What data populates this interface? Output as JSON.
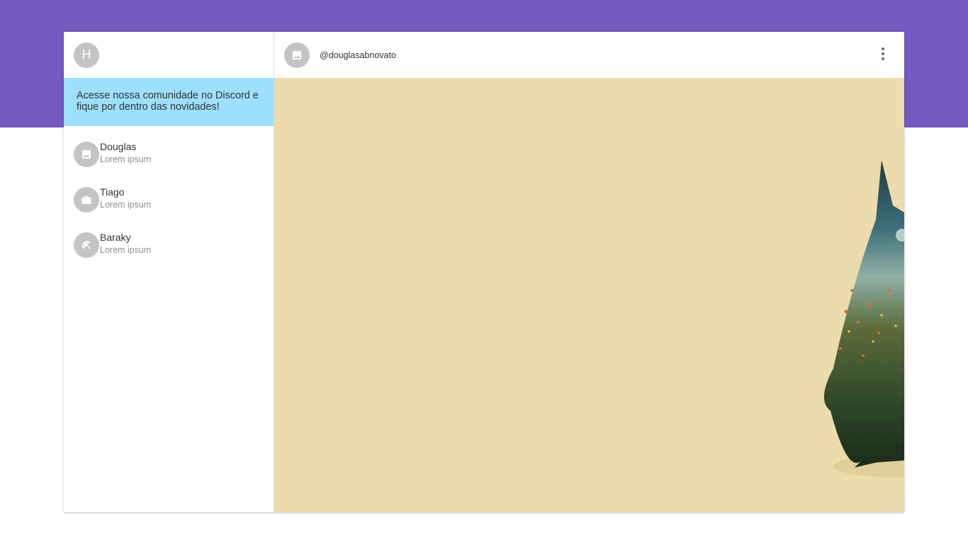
{
  "sidebar": {
    "profile_initial": "H",
    "banner_text": "Acesse nossa comunidade no Discord e fique por dentro das novidades!",
    "contacts": [
      {
        "name": "Douglas",
        "subtitle": "Lorem ipsum",
        "icon": "image-icon"
      },
      {
        "name": "Tiago",
        "subtitle": "Lorem ipsum",
        "icon": "briefcase-icon"
      },
      {
        "name": "Baraky",
        "subtitle": "Lorem ipsum",
        "icon": "beach-umbrella-icon"
      }
    ]
  },
  "chat": {
    "title": "@douglasabnovato",
    "avatar_icon": "image-icon",
    "menu_icon": "more-vert-icon"
  },
  "colors": {
    "header_band": "#7658c3",
    "banner": "#9de0fe",
    "avatar": "#c4c4c4",
    "chat_background": "#ecdbab"
  }
}
